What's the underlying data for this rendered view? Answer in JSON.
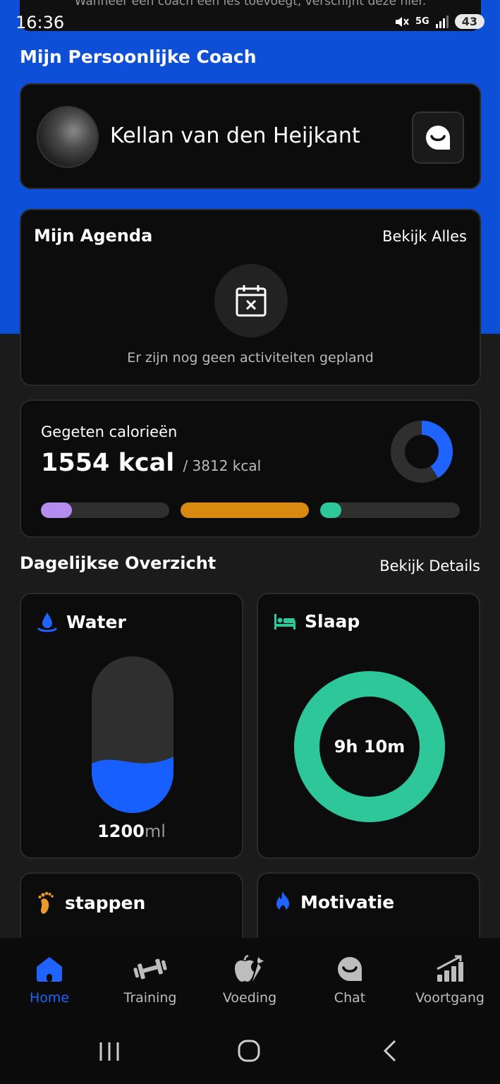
{
  "banner": {
    "text": "Wanneer een coach een les toevoegt, verschijnt deze hier."
  },
  "status_bar": {
    "time": "16:36",
    "network": "5G",
    "battery": "43"
  },
  "coach": {
    "heading": "Mijn Persoonlijke Coach",
    "name": "Kellan van den Heijkant"
  },
  "agenda": {
    "title": "Mijn Agenda",
    "link": "Bekijk Alles",
    "empty_text": "Er zijn nog geen activiteiten gepland"
  },
  "calories": {
    "label": "Gegeten calorieën",
    "eaten": "1554 kcal",
    "total": "/ 3812 kcal",
    "progress_fraction": 0.41,
    "macros": [
      {
        "fraction": 0.24,
        "color": "#b48cf0"
      },
      {
        "fraction": 1.0,
        "color": "#d88a10"
      },
      {
        "fraction": 0.15,
        "color": "#2ec79a"
      }
    ]
  },
  "overview": {
    "title": "Dagelijkse Overzicht",
    "link": "Bekijk Details"
  },
  "water": {
    "title": "Water",
    "amount": "1200",
    "unit": "ml",
    "fill_fraction": 0.35
  },
  "sleep": {
    "title": "Slaap",
    "value": "9h 10m"
  },
  "steps": {
    "title": "stappen"
  },
  "motivation": {
    "title": "Motivatie"
  },
  "nav": [
    {
      "label": "Home",
      "icon": "home-icon",
      "active": true
    },
    {
      "label": "Training",
      "icon": "dumbbell-icon"
    },
    {
      "label": "Voeding",
      "icon": "food-icon"
    },
    {
      "label": "Chat",
      "icon": "chat-icon"
    },
    {
      "label": "Voortgang",
      "icon": "progress-chart-icon"
    }
  ],
  "colors": {
    "accent": "#1f64ff",
    "header_blue": "#0d4fd6",
    "sleep": "#2ec79a",
    "water": "#1760ff"
  }
}
